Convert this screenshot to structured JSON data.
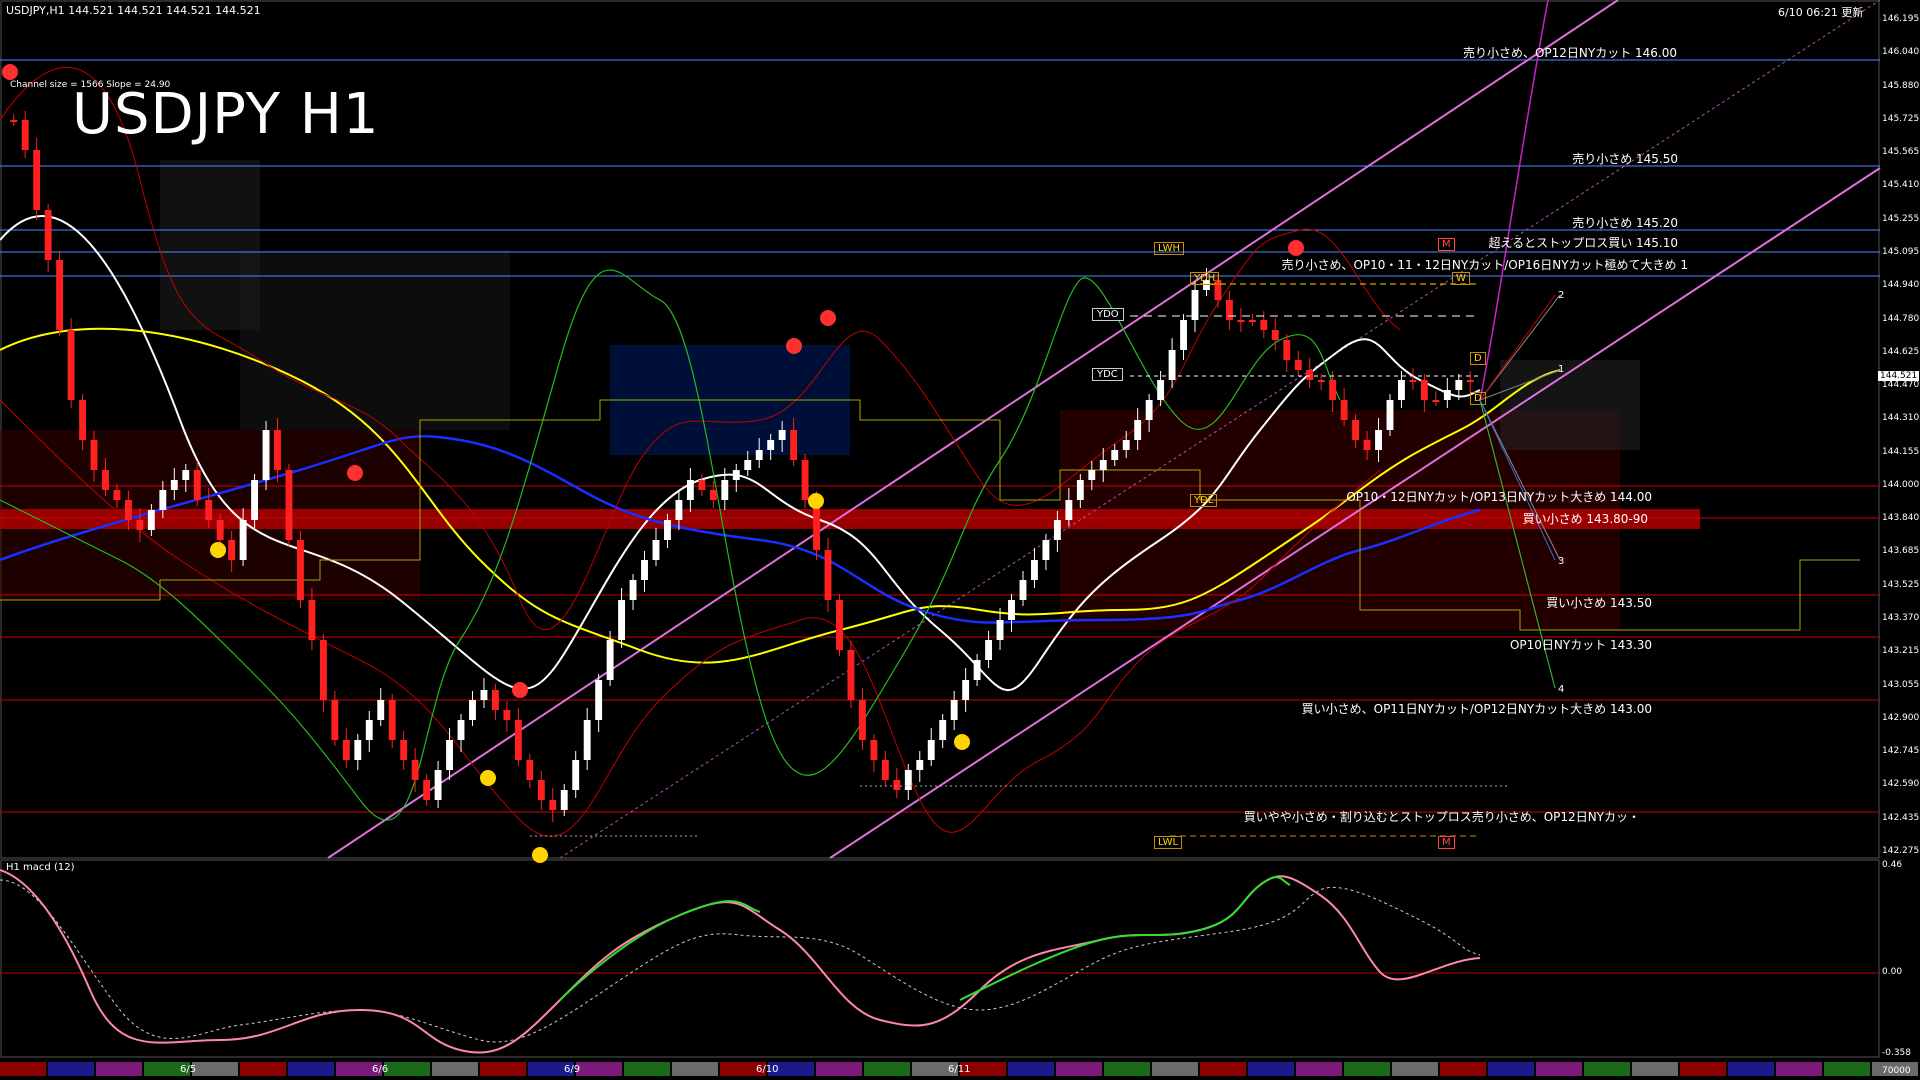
{
  "header": {
    "symbol_line": "USDJPY,H1  144.521 144.521 144.521 144.521",
    "update_time": "6/10 06:21 更新"
  },
  "title": "USDJPY H1",
  "channel_info": "Channel size = 1566 Slope = 24.90",
  "current_price": "144.521",
  "price_ticks": [
    "146.195",
    "146.040",
    "145.880",
    "145.725",
    "145.565",
    "145.410",
    "145.255",
    "145.095",
    "144.940",
    "144.780",
    "144.625",
    "144.470",
    "144.310",
    "144.155",
    "144.000",
    "143.840",
    "143.685",
    "143.525",
    "143.370",
    "143.215",
    "143.055",
    "142.900",
    "142.745",
    "142.590",
    "142.435",
    "142.275"
  ],
  "level_labels": [
    {
      "text": "売り小さめ、OP12日NYカット 146.00",
      "color": "#4a8cff"
    },
    {
      "text": "売り小さめ 145.50",
      "color": "#4a8cff"
    },
    {
      "text": "売り小さめ 145.20",
      "color": "#4a8cff"
    },
    {
      "text": "超えるとストップロス買い 145.10",
      "color": "#4a8cff"
    },
    {
      "text": "売り小さめ、OP10・11・12日NYカット/OP16日NYカット極めて大きめ 1",
      "color": "#4a8cff"
    },
    {
      "text": "OP10・12日NYカット/OP13日NYカット大きめ 144.00",
      "color": "#d00000"
    },
    {
      "text": "買い小さめ 143.80-90",
      "color": "#d00000"
    },
    {
      "text": "買い小さめ 143.50",
      "color": "#d00000"
    },
    {
      "text": "OP10日NYカット 143.30",
      "color": "#d00000"
    },
    {
      "text": "買い小さめ、OP11日NYカット/OP12日NYカット大きめ 143.00",
      "color": "#d00000"
    },
    {
      "text": "買いやや小さめ・割り込むとストップロス売り小さめ、OP12日NYカッ・",
      "color": "#d00000"
    }
  ],
  "markers": {
    "ydo": "YDO",
    "ydc": "YDC",
    "ydh": "YDH",
    "ydl": "YDL",
    "lwh": "LWH",
    "lwl": "LWL",
    "m_top": "M",
    "m_bottom": "M",
    "w": "W",
    "d1": "D",
    "d2": "D",
    "n1": "1",
    "n2": "2",
    "n3": "3",
    "n4": "4"
  },
  "macd": {
    "title": "H1  macd (12)",
    "ticks": [
      "0.46",
      "0.00",
      "-0.358"
    ]
  },
  "date_labels": [
    "6/5",
    "6/6",
    "6/9",
    "6/10",
    "6/11"
  ],
  "volume_label": "70000",
  "colors": {
    "blue_line": "#2f6fd0",
    "red_line": "#c00000",
    "channel": "#e070e0",
    "sma_white": "#ffffff",
    "sma_yellow": "#ffff00",
    "sma_blue": "#1a2fff",
    "macd_up": "#33dd33",
    "macd_down": "#ff88aa"
  }
}
